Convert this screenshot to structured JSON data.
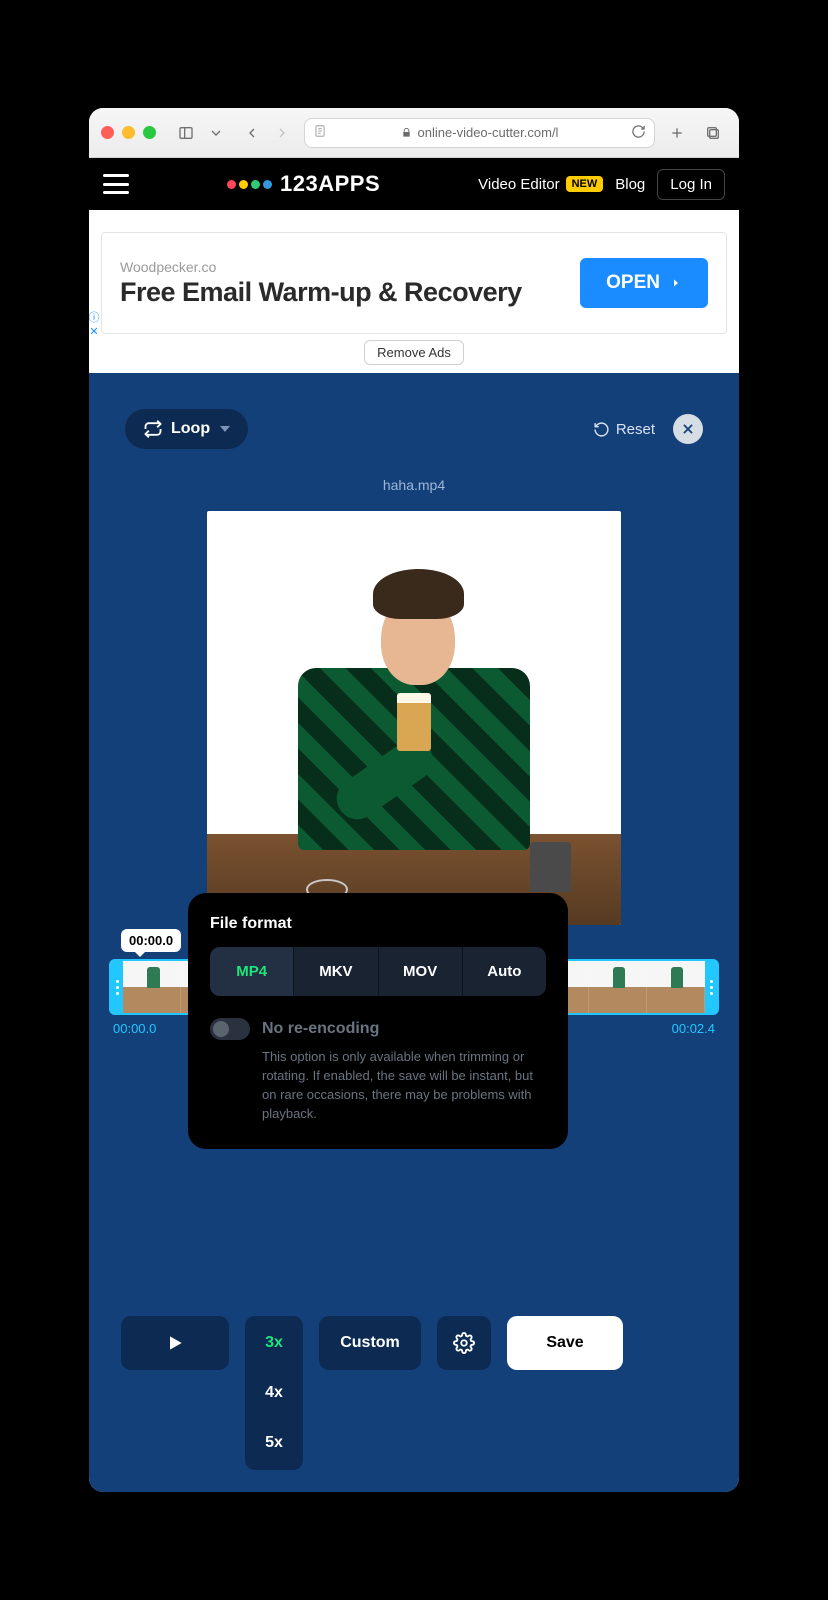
{
  "browser": {
    "url": "online-video-cutter.com/l"
  },
  "nav": {
    "brand": "123APPS",
    "video_editor": "Video Editor",
    "new_badge": "NEW",
    "blog": "Blog",
    "login": "Log In"
  },
  "ad": {
    "advertiser": "Woodpecker.co",
    "headline": "Free Email Warm-up & Recovery",
    "cta": "OPEN",
    "remove": "Remove Ads"
  },
  "toolbar": {
    "loop_label": "Loop",
    "reset_label": "Reset"
  },
  "file": {
    "name": "haha.mp4",
    "tooltip": "00:00.0"
  },
  "timecodes": {
    "start": "00:00.0",
    "end": "00:02.4"
  },
  "popover": {
    "title": "File format",
    "formats": [
      "MP4",
      "MKV",
      "MOV",
      "Auto"
    ],
    "toggle_label": "No re-encoding",
    "toggle_desc": "This option is only available when trimming or rotating. If enabled, the save will be instant, but on rare occasions, there may be problems with playback."
  },
  "bottom": {
    "speeds": [
      "3x",
      "4x",
      "5x"
    ],
    "custom": "Custom",
    "save": "Save"
  }
}
